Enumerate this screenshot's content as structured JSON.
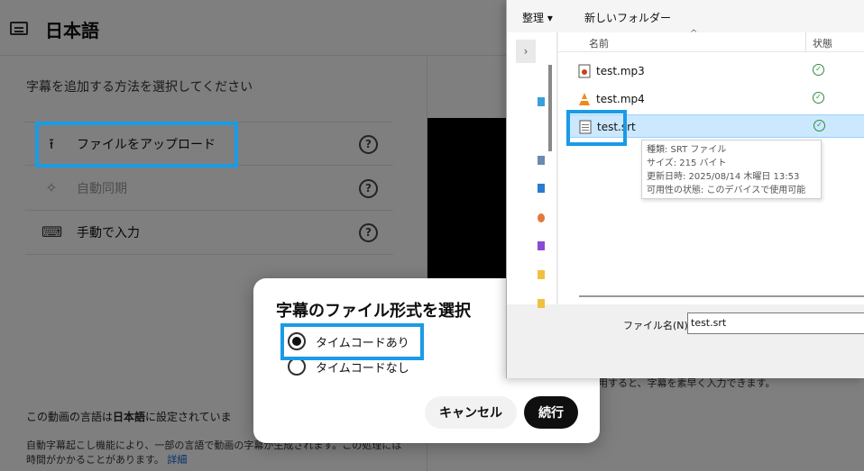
{
  "studio": {
    "title": "日本語",
    "instruction": "字幕を追加する方法を選択してください",
    "options": [
      {
        "label": "ファイルをアップロード",
        "icon": "upload-icon",
        "help": "?"
      },
      {
        "label": "自動同期",
        "icon": "sparkle-icon",
        "help": "?",
        "disabled": true
      },
      {
        "label": "手動で入力",
        "icon": "keyboard-icon",
        "help": "?"
      }
    ],
    "lang_note_prefix": "この動画の言語は",
    "lang_note_bold": "日本語",
    "lang_note_suffix": "に設定されていま",
    "auto_note": "自動字幕起こし機能により、一部の言語で動画の字幕が生成されます。この処理には時間がかかることがあります。",
    "auto_note_link": "詳細",
    "right_note": "使用すると、字幕を素早く入力できます。"
  },
  "format_dialog": {
    "title": "字幕のファイル形式を選択",
    "options": [
      {
        "label": "タイムコードあり",
        "checked": true
      },
      {
        "label": "タイムコードなし",
        "checked": false
      }
    ],
    "cancel_label": "キャンセル",
    "continue_label": "続行"
  },
  "file_dialog": {
    "toolbar": {
      "organize": "整理 ▾",
      "new_folder": "新しいフォルダー"
    },
    "columns": {
      "name": "名前",
      "status": "状態"
    },
    "files": [
      {
        "name": "test.mp3",
        "icon": "audio-file-icon"
      },
      {
        "name": "test.mp4",
        "icon": "vlc-file-icon"
      },
      {
        "name": "test.srt",
        "icon": "text-file-icon",
        "selected": true
      }
    ],
    "status_glyph": "✓",
    "tooltip": [
      "種類: SRT ファイル",
      "サイズ: 215 バイト",
      "更新日時: 2025/08/14 木曜日 13:53",
      "可用性の状態: このデバイスで使用可能"
    ],
    "filename_label": "ファイル名(N):",
    "filename_value": "test.srt"
  },
  "colors": {
    "highlight": "#1a9be6",
    "selection": "#cce8ff",
    "status_ok": "#2e8b3d"
  }
}
